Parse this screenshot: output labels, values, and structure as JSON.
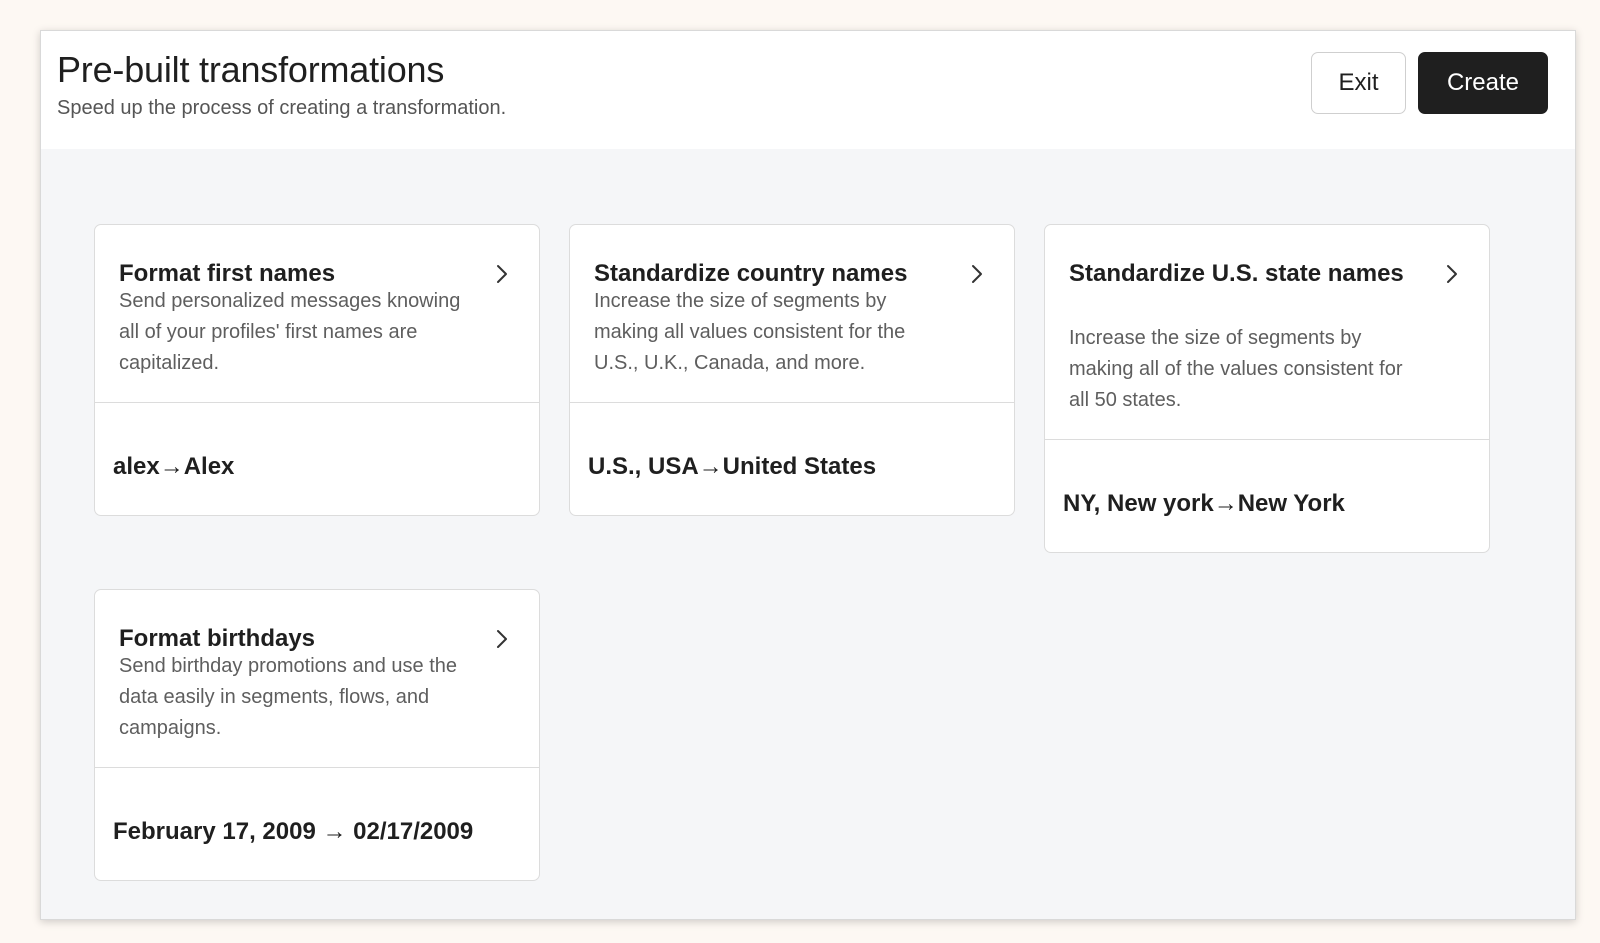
{
  "header": {
    "title": "Pre-built transformations",
    "subtitle": "Speed up the process of creating a transformation.",
    "exit_label": "Exit",
    "create_label": "Create"
  },
  "cards": [
    {
      "title": "Format first names",
      "description": "Send personalized messages knowing all of your profiles' first names are capitalized.",
      "example": "alex→Alex",
      "icon": "chevron-right-icon"
    },
    {
      "title": "Standardize country names",
      "description": "Increase the size of segments by making all values consistent for the U.S., U.K., Canada, and more.",
      "example": "U.S., USA→United States",
      "icon": "chevron-right-icon"
    },
    {
      "title": "Standardize U.S. state names",
      "description": "Increase the size of segments by making all of the values consistent for all 50 states.",
      "example": "NY, New york→New York",
      "icon": "chevron-right-icon"
    },
    {
      "title": "Format birthdays",
      "description": "Send birthday promotions and use the data easily in segments, flows, and campaigns.",
      "example": "February 17, 2009 → 02/17/2009",
      "icon": "chevron-right-icon"
    }
  ],
  "colors": {
    "primary_button": "#1f1f1f",
    "content_background": "#f5f6f8",
    "outer_background": "#fdf8f3"
  }
}
